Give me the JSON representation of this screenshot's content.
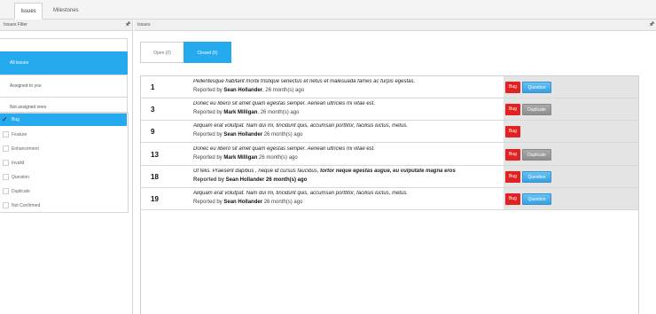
{
  "top_tabs": [
    {
      "label": "Issues"
    },
    {
      "label": "Milestones"
    }
  ],
  "left_panel": {
    "title": "Issues Filter",
    "filters": [
      {
        "label": "All issues"
      },
      {
        "label": "Assigned to you"
      },
      {
        "label": "Not assigned ones"
      }
    ],
    "categories": [
      {
        "label": "Bug",
        "checked": true
      },
      {
        "label": "Feature",
        "checked": false
      },
      {
        "label": "Enhancement",
        "checked": false
      },
      {
        "label": "Invalid",
        "checked": false
      },
      {
        "label": "Question",
        "checked": false
      },
      {
        "label": "Duplicate",
        "checked": false
      },
      {
        "label": "Not Confirmed",
        "checked": false
      }
    ],
    "check_glyph": "✓"
  },
  "right_panel": {
    "title": "Issues",
    "subtabs": [
      {
        "label": "Open (0)"
      },
      {
        "label": "Closed (6)"
      }
    ],
    "reported_by_prefix": "Reported by",
    "issues": [
      {
        "id": "1",
        "title": "Pellentesque habitant morbi tristique senectus et netus et malesuada fames ac turpis egestas.",
        "reporter": "Sean Hollander",
        "age": ", 26 month(s) ago",
        "tags": [
          "Bug",
          "Question"
        ]
      },
      {
        "id": "3",
        "title": "Donec eu libero sit amet quam egestas semper. Aenean ultricies mi vitae est.",
        "reporter": "Mark Milligan",
        "age": ", 26 month(s) ago",
        "tags": [
          "Bug",
          "Duplicate"
        ]
      },
      {
        "id": "9",
        "title": "Aliquam erat volutpat. Nam dui mi, tincidunt quis, accumsan porttitor, facilisis luctus, metus.",
        "reporter": "Sean Hollander",
        "age": " 26 month(s) ago",
        "tags": [
          "Bug"
        ]
      },
      {
        "id": "13",
        "title": "Donec eu libero sit amet quam egestas semper. Aenean ultricies mi vitae est.",
        "reporter": "Mark Milligan",
        "age": " 26 month(s) ago",
        "tags": [
          "Bug",
          "Duplicate"
        ]
      },
      {
        "id": "18",
        "title_plain": "Ut felis. Praesent dapibus , neque id cursus faucibus, ",
        "title_bold": "tortor neque egestas augue, eu vulputate magna eros",
        "reporter": "Sean Hollander 26 month(s) ago",
        "age": "",
        "tags": [
          "Bug",
          "Question"
        ],
        "meta_all_bold": true
      },
      {
        "id": "19",
        "title": "Aliquam erat volutpat. Nam dui mi, tincidunt quis, accumsan porttitor, facilisis luctus, metus.",
        "reporter": "Sean Hollander",
        "age": " 26 month(s) ago",
        "tags": [
          "Bug",
          "Question"
        ]
      }
    ]
  },
  "colors": {
    "accent": "#25aaf0",
    "bug_tag": "#e22222",
    "question_tag": "#3a9fe0",
    "duplicate_tag": "#8e8e8e",
    "tag_column_bg": "#e4e4e4"
  },
  "icons": {
    "pin": "pin-icon"
  }
}
